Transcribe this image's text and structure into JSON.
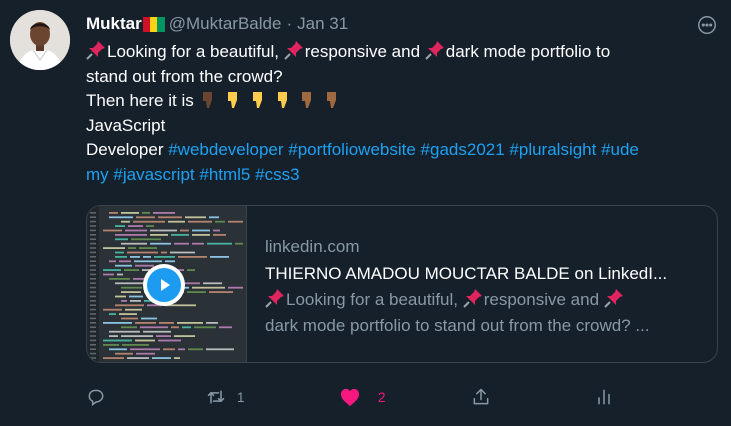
{
  "tweet": {
    "author": {
      "name": "Muktar",
      "handle": "@MuktarBalde",
      "separator": "·",
      "date": "Jan 31",
      "flag_colors": [
        "#ce1126",
        "#fcd116",
        "#009460"
      ]
    },
    "body": {
      "line1_a": "Looking for a beautiful, ",
      "line1_b": "responsive and ",
      "line1_c": "dark mode portfolio to",
      "line2": "stand out from the crowd?",
      "line3": "Then here it is ",
      "line4": "JavaScript",
      "line5_prefix": "Developer ",
      "line5_hashtags": "#webdeveloper #portfoliowebsite #gads2021 #pluralsight #ude",
      "line6_hashtags": "my #javascript #html5 #css3",
      "emojis": [
        "pushpin",
        "pointing-down-dark",
        "pointing-down",
        "pointing-down",
        "pointing-down",
        "pointing-down-medium-dark",
        "pointing-down-medium-dark"
      ]
    },
    "card": {
      "domain": "linkedin.com",
      "title": "THIERNO AMADOU MOUCTAR BALDE on LinkedI...",
      "desc_line1_a": "Looking for a beautiful, ",
      "desc_line1_b": "responsive and ",
      "desc_line2": "dark mode portfolio to stand out from the crowd? ...",
      "thumbnail": "code-editor-screenshot",
      "play_icon": "play-icon"
    },
    "actions": {
      "reply_icon": "reply-icon",
      "retweet_icon": "retweet-icon",
      "retweet_count": "1",
      "like_icon": "heart-filled-icon",
      "like_count": "2",
      "share_icon": "share-icon",
      "analytics_icon": "analytics-icon"
    },
    "colors": {
      "background": "#15202b",
      "link": "#1da1f2",
      "muted": "#8899a6",
      "like": "#f91880",
      "border": "#38444d"
    }
  }
}
